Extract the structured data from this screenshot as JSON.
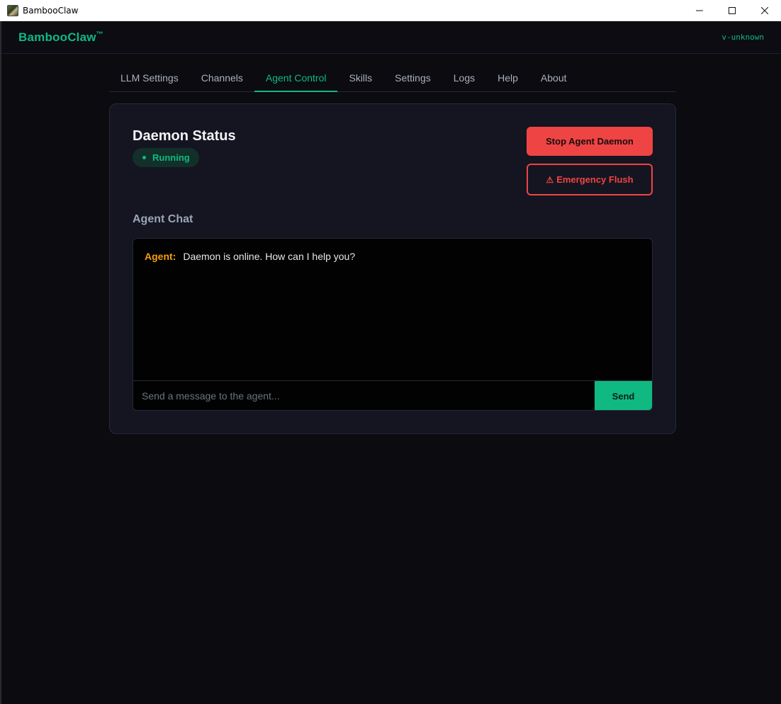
{
  "window": {
    "title": "BambooClaw",
    "icon": "bamboo-claw-app-icon",
    "controls": [
      "minimize-icon",
      "maximize-icon",
      "close-icon"
    ]
  },
  "header": {
    "brand": "BambooClaw",
    "trademark": "™",
    "version": "v-unknown"
  },
  "tabs": [
    {
      "label": "LLM Settings",
      "active": false
    },
    {
      "label": "Channels",
      "active": false
    },
    {
      "label": "Agent Control",
      "active": true
    },
    {
      "label": "Skills",
      "active": false
    },
    {
      "label": "Settings",
      "active": false
    },
    {
      "label": "Logs",
      "active": false
    },
    {
      "label": "Help",
      "active": false
    },
    {
      "label": "About",
      "active": false
    }
  ],
  "daemon": {
    "title": "Daemon Status",
    "status": "Running",
    "stop_label": "Stop Agent Daemon",
    "flush_icon": "⚠",
    "flush_label": "Emergency Flush"
  },
  "chat": {
    "title": "Agent Chat",
    "messages": [
      {
        "sender": "Agent:",
        "text": "Daemon is online. How can I help you?"
      }
    ],
    "input_value": "",
    "placeholder": "Send a message to the agent...",
    "send_label": "Send"
  },
  "colors": {
    "accent": "#10b981",
    "danger": "#ef4444",
    "agent_name": "#f59e0b",
    "background": "#0b0b10",
    "card": "#141520"
  }
}
